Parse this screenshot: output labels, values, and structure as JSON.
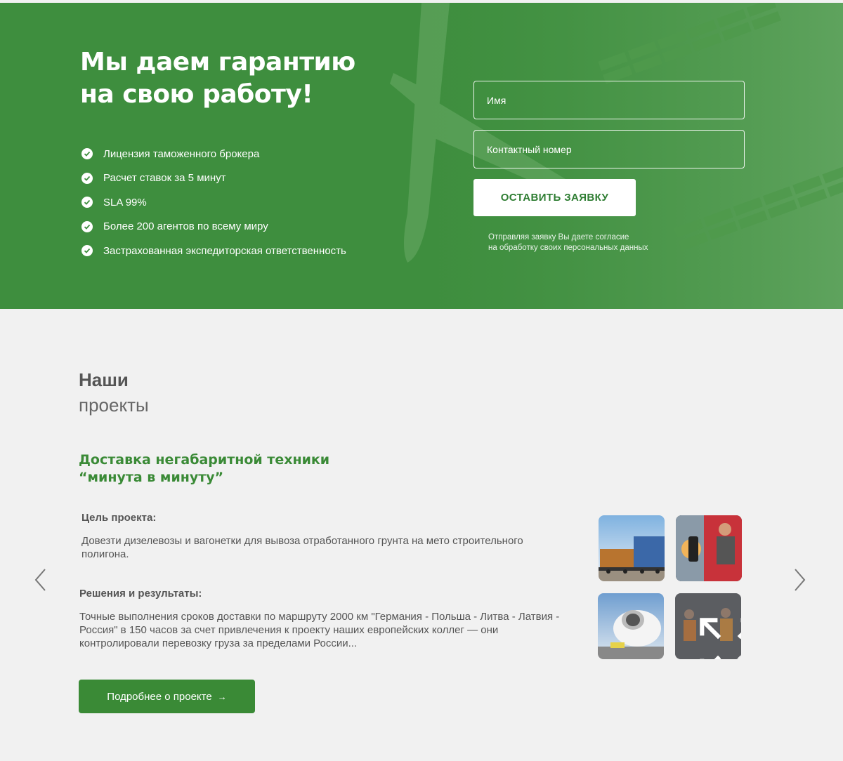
{
  "hero": {
    "title_line1": "Мы даем гарантию",
    "title_line2": "на свою работу!",
    "features": [
      "Лицензия таможенного брокера",
      "Расчет ставок за 5 минут",
      "SLA 99%",
      "Более 200 агентов по всему миру",
      "Застрахованная экспедиторская ответственность"
    ],
    "background_color": "#3e8e3e"
  },
  "form": {
    "name_placeholder": "Имя",
    "phone_placeholder": "Контактный номер",
    "submit_label": "ОСТАВИТЬ ЗАЯВКУ",
    "consent_line1": "Отправляя заявку Вы даете согласие",
    "consent_line2": "на обработку своих персональных данных"
  },
  "projects": {
    "heading_bold": "Наши",
    "heading_light": "проекты",
    "title_line1": "Доставка негабаритной техники",
    "title_line2": "“минута в минуту”",
    "goal_label": "Цель проекта:",
    "goal_text": "Довезти дизелевозы и вагонетки для вывоза отработанного грунта на мето строительного полигона.",
    "results_label": "Решения и результаты:",
    "results_text": "Точные выполнения сроков доставки по маршруту 2000 км \"Германия - Польша - Литва - Латвия - Россия\" в 150 часов за счет привлечения к проекту наших европейских коллег — они контролировали перевозку груза за пределами России...",
    "more_label": "Подробнее о проекте",
    "more_arrow": "→",
    "accent_color": "#3a8a36",
    "gallery": [
      {
        "icon": "freight-train-photo"
      },
      {
        "icon": "truck-driver-photo"
      },
      {
        "icon": "cargo-plane-photo"
      },
      {
        "icon": "workers-photo-expand"
      }
    ]
  }
}
